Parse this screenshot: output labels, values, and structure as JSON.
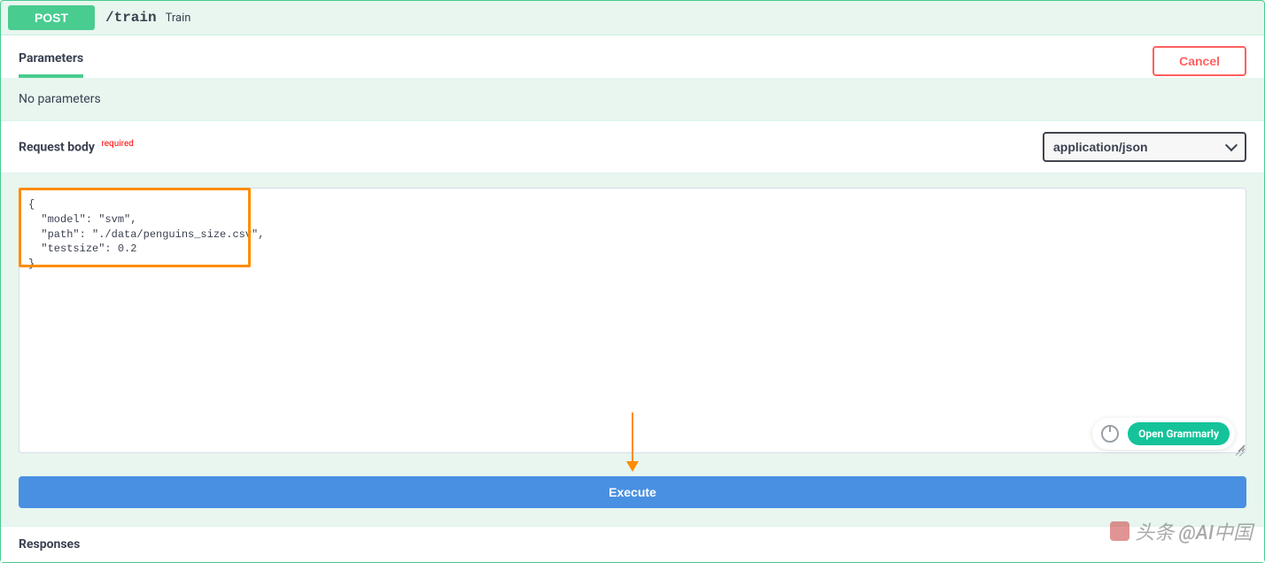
{
  "endpoint": {
    "method": "POST",
    "path": "/train",
    "summary": "Train"
  },
  "tabs": {
    "parameters": "Parameters"
  },
  "actions": {
    "cancel": "Cancel",
    "execute": "Execute"
  },
  "params": {
    "empty_message": "No parameters"
  },
  "request_body": {
    "label": "Request body",
    "required_tag": "required",
    "content_type": "application/json",
    "value": "{\n  \"model\": \"svm\",\n  \"path\": \"./data/penguins_size.csv\",\n  \"testsize\": 0.2\n}"
  },
  "responses": {
    "label": "Responses"
  },
  "grammarly": {
    "open_label": "Open Grammarly"
  },
  "watermark": {
    "text": "头条 @AI中国"
  }
}
